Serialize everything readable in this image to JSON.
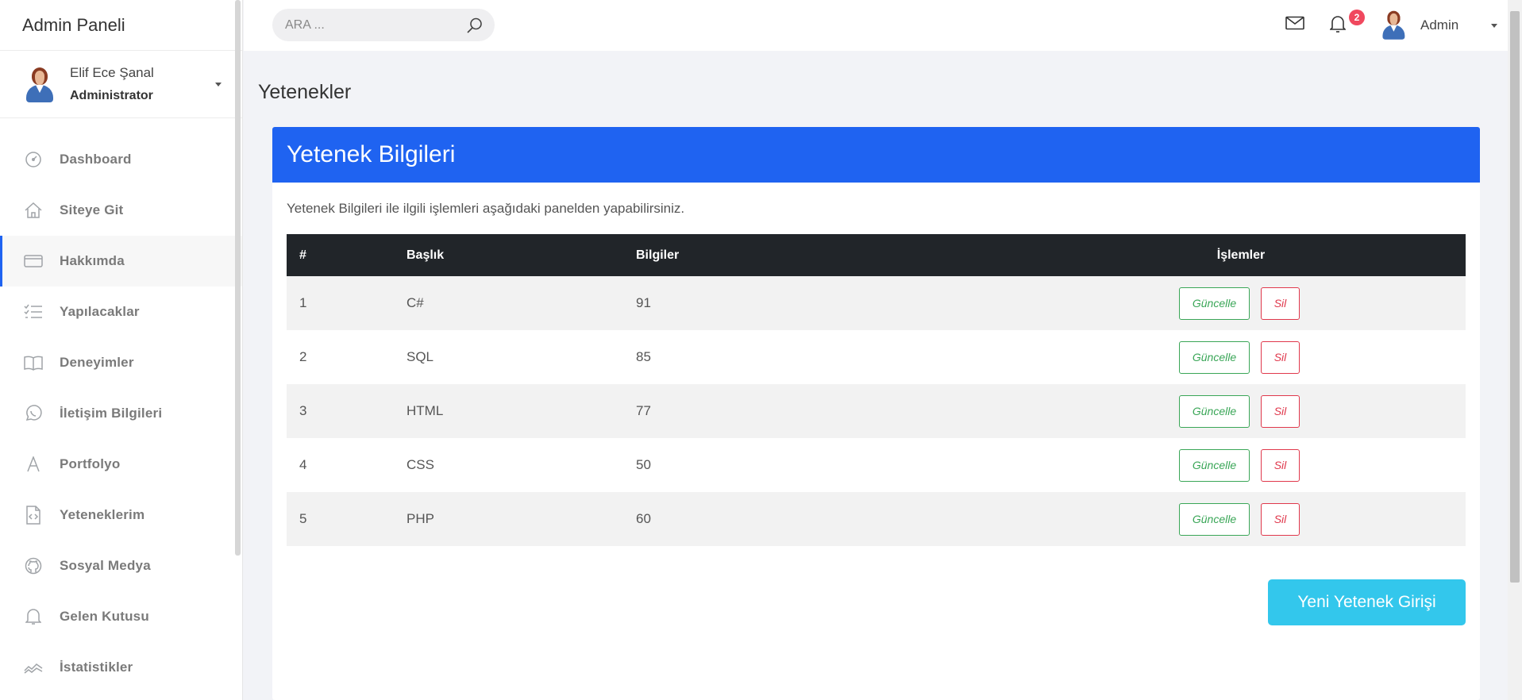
{
  "brand": "Admin Paneli",
  "profile": {
    "name": "Elif Ece Şanal",
    "role": "Administrator"
  },
  "sidebar": {
    "items": [
      {
        "label": "Dashboard",
        "icon": "speedometer-icon"
      },
      {
        "label": "Siteye Git",
        "icon": "home-icon"
      },
      {
        "label": "Hakkımda",
        "icon": "card-icon",
        "active": true
      },
      {
        "label": "Yapılacaklar",
        "icon": "checklist-icon"
      },
      {
        "label": "Deneyimler",
        "icon": "book-icon"
      },
      {
        "label": "İletişim Bilgileri",
        "icon": "whatsapp-icon"
      },
      {
        "label": "Portfolyo",
        "icon": "letter-a-icon"
      },
      {
        "label": "Yeteneklerim",
        "icon": "code-file-icon"
      },
      {
        "label": "Sosyal Medya",
        "icon": "github-icon"
      },
      {
        "label": "Gelen Kutusu",
        "icon": "bell-icon"
      },
      {
        "label": "İstatistikler",
        "icon": "chart-line-icon"
      }
    ]
  },
  "topbar": {
    "search_placeholder": "ARA ...",
    "notification_count": "2",
    "user": "Admin"
  },
  "page": {
    "title": "Yetenekler",
    "card_title": "Yetenek Bilgileri",
    "description": "Yetenek Bilgileri ile ilgili işlemleri aşağıdaki panelden yapabilirsiniz.",
    "new_button": "Yeni Yetenek Girişi"
  },
  "table": {
    "headers": [
      "#",
      "Başlık",
      "Bilgiler",
      "İşlemler"
    ],
    "update_label": "Güncelle",
    "delete_label": "Sil",
    "rows": [
      {
        "id": "1",
        "title": "C#",
        "info": "91"
      },
      {
        "id": "2",
        "title": "SQL",
        "info": "85"
      },
      {
        "id": "3",
        "title": "HTML",
        "info": "77"
      },
      {
        "id": "4",
        "title": "CSS",
        "info": "50"
      },
      {
        "id": "5",
        "title": "PHP",
        "info": "60"
      }
    ]
  },
  "colors": {
    "primary": "#1f63f1",
    "success": "#3aa657",
    "danger": "#e0384c",
    "info": "#33c7ec",
    "table_head": "#212529"
  }
}
